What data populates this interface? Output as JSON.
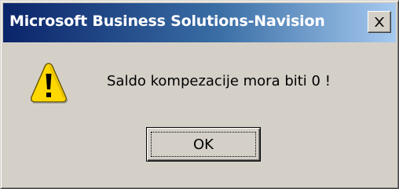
{
  "window": {
    "title": "Microsoft Business Solutions-Navision",
    "close_icon": "close-icon"
  },
  "dialog": {
    "icon": "warning-icon",
    "message": "Saldo kompezacije mora biti 0 !",
    "ok_label": "OK"
  },
  "colors": {
    "titlebar_start": "#0a246a",
    "titlebar_end": "#a6caf0",
    "face": "#d4d0c8",
    "warning_yellow": "#ffd800"
  }
}
